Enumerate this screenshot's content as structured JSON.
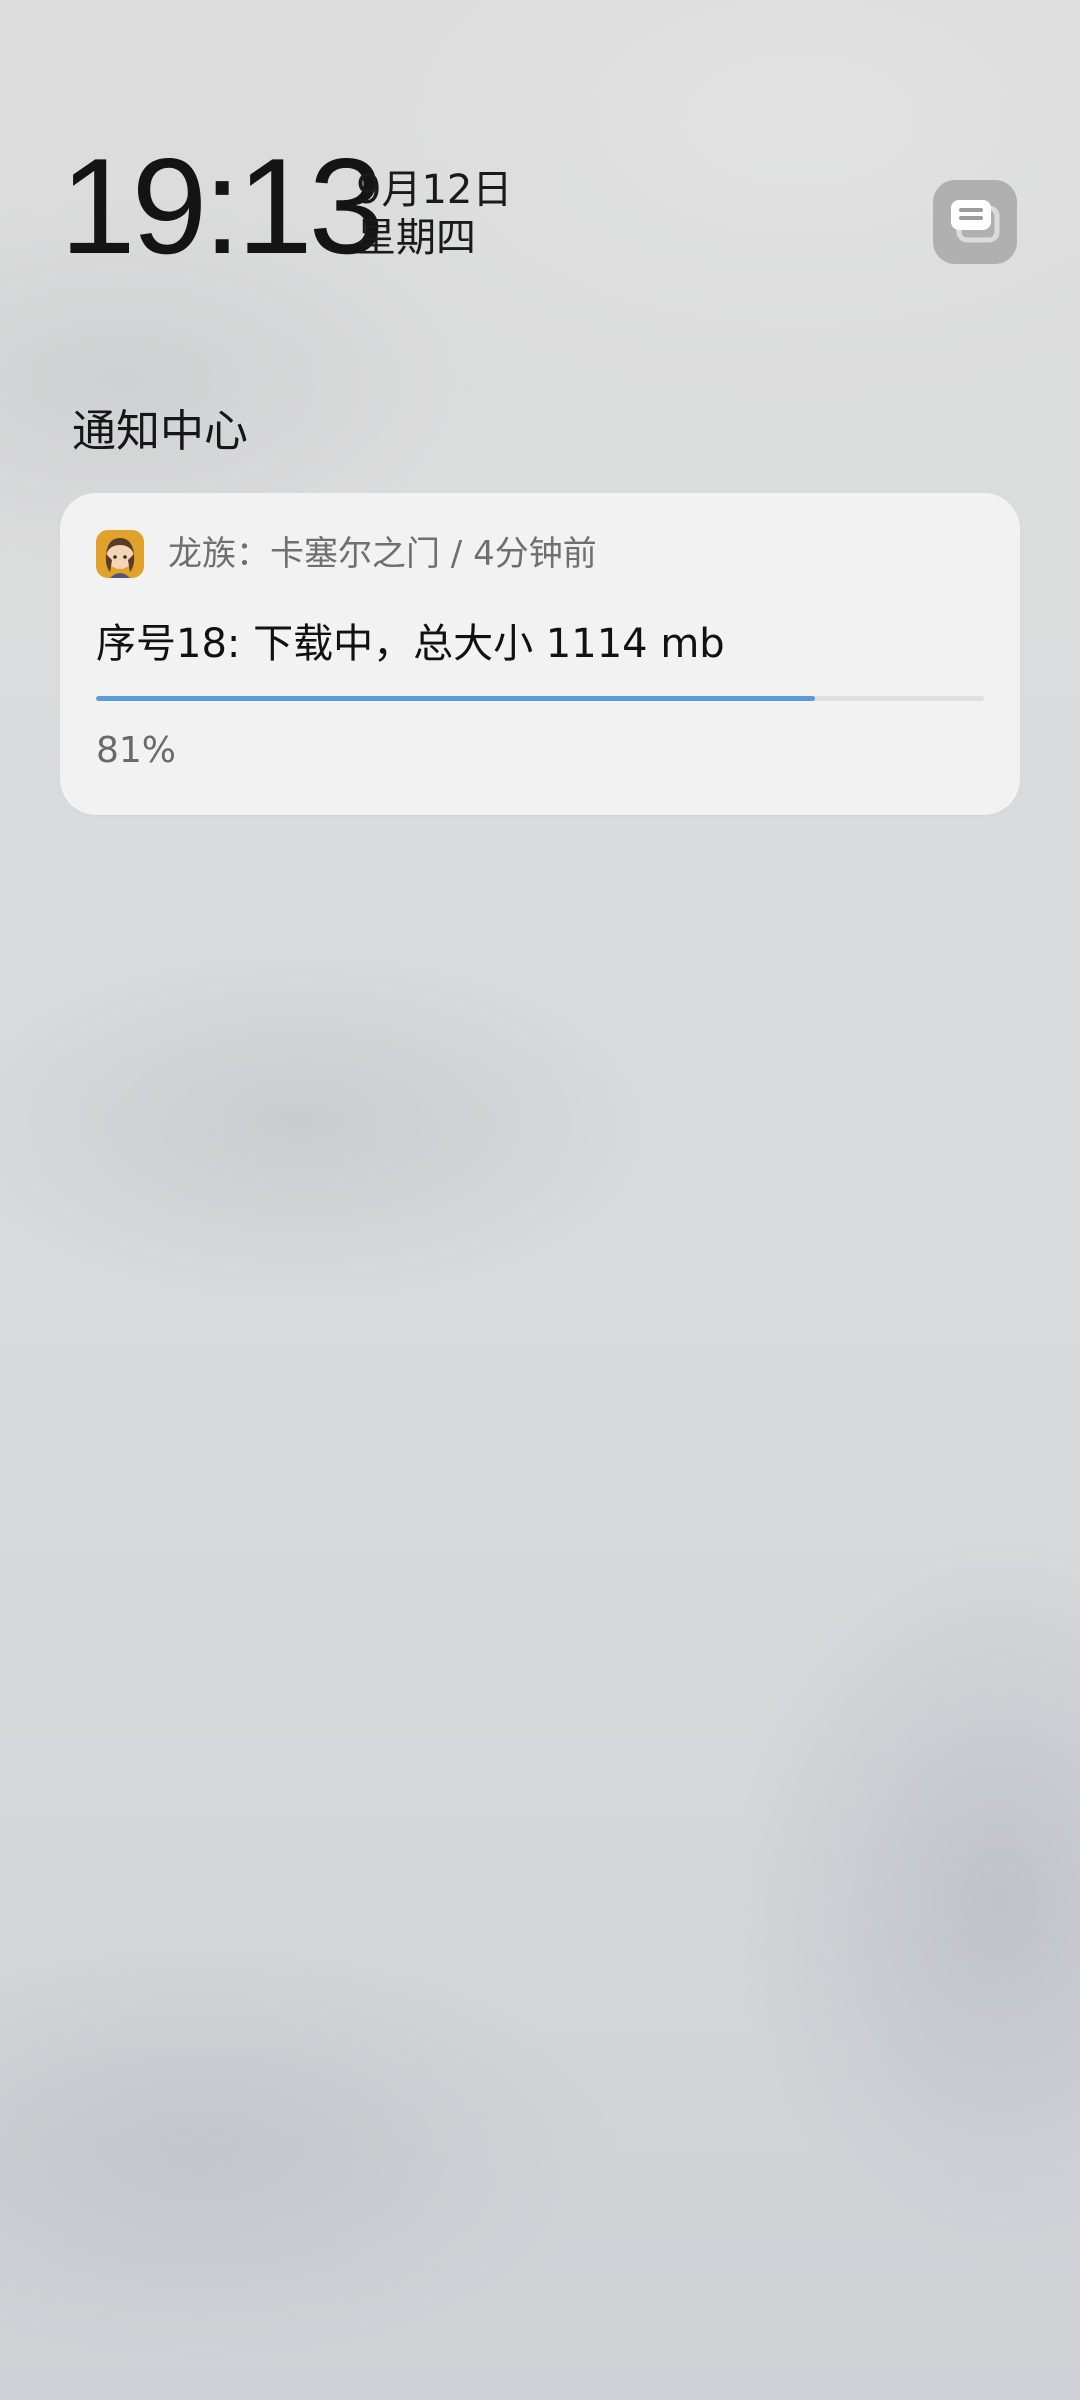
{
  "lockscreen": {
    "time": "19:13",
    "date": "9月12日",
    "weekday": "星期四"
  },
  "notification_center": {
    "title": "通知中心",
    "toggle_icon": "notification-list-icon"
  },
  "notification": {
    "app_icon": "game-app-icon",
    "header": "龙族：卡塞尔之门 / 4分钟前",
    "title": "序号18: 下载中，总大小 1114 mb",
    "progress_percent": 81,
    "progress_text": "81%",
    "progress_color": "#5b9ad8"
  }
}
